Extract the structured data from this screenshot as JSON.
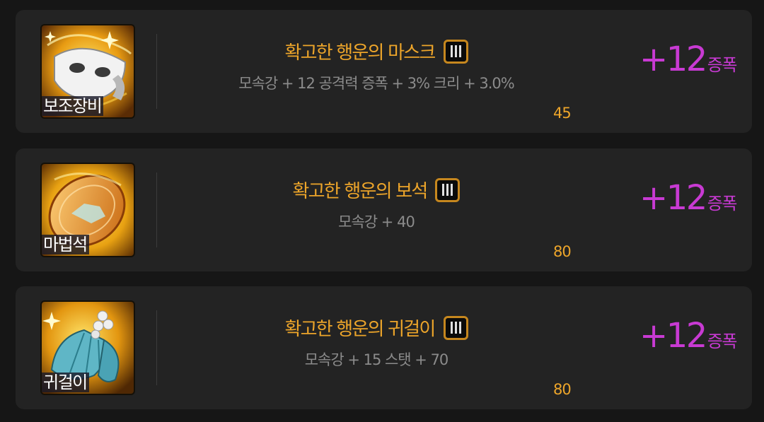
{
  "items": [
    {
      "slot_label": "보조장비",
      "icon": "white-mask-icon",
      "name": "확고한 행운의 마스크",
      "tier_badge": "III",
      "description": "모속강 + 12 공격력 증폭 + 3% 크리 + 3.0%",
      "level": "45",
      "bonus_value": "+12",
      "bonus_unit": "증폭"
    },
    {
      "slot_label": "마법석",
      "icon": "orange-gem-icon",
      "name": "확고한 행운의 보석",
      "tier_badge": "III",
      "description": "모속강 + 40",
      "level": "80",
      "bonus_value": "+12",
      "bonus_unit": "증폭"
    },
    {
      "slot_label": "귀걸이",
      "icon": "blue-wing-earring-icon",
      "name": "확고한 행운의 귀걸이",
      "tier_badge": "III",
      "description": "모속강 + 15 스탯 + 70",
      "level": "80",
      "bonus_value": "+12",
      "bonus_unit": "증폭"
    }
  ],
  "colors": {
    "background": "#161616",
    "card": "#232323",
    "item_name": "#eda52a",
    "description": "#8b8b8b",
    "bonus": "#c83ad3",
    "badge_border": "#c6871e"
  }
}
